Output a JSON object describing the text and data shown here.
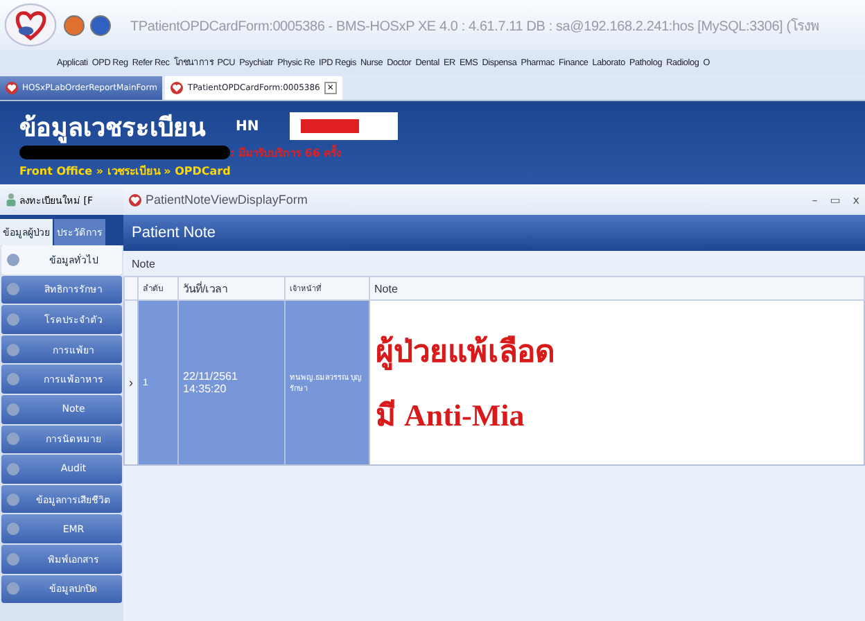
{
  "window": {
    "title": "TPatientOPDCardForm:0005386 - BMS-HOSxP XE 4.0 : 4.61.7.11 DB : sa@192.168.2.241:hos [MySQL:3306] (โรงพ"
  },
  "menu": [
    "Applicati",
    "OPD Reg",
    "Refer Rec",
    "โภชนาการ",
    "PCU",
    "Psychiatr",
    "Physic Re",
    "IPD Regis",
    "Nurse",
    "Doctor",
    "Dental",
    "ER",
    "EMS",
    "Dispensa",
    "Pharmac",
    "Finance",
    "Laborato",
    "Patholog",
    "Radiolog",
    "O"
  ],
  "doc_tabs": [
    {
      "label": "HOSxPLabOrderReportMainForm",
      "selected": false
    },
    {
      "label": "TPatientOPDCardForm:0005386",
      "selected": true,
      "close": "✕"
    }
  ],
  "header": {
    "title": "ข้อมูลเวชระเบียน",
    "hn_label": "HN",
    "visit_text": ": มีมารับบริการ 66 ครั้ง",
    "breadcrumb": "Front Office » เวชระเบียน » OPDCard"
  },
  "toolbar": {
    "new_button": "ลงทะเบียนใหม่ [F"
  },
  "side_tabs": [
    {
      "label": "ข้อมูลผู้ป่วย",
      "selected": true
    },
    {
      "label": "ประวัติการ",
      "selected": false
    }
  ],
  "sidebar": {
    "items": [
      {
        "label": "ข้อมูลทั่วไป",
        "selected": true
      },
      {
        "label": "สิทธิการรักษา",
        "selected": false
      },
      {
        "label": "โรคประจำตัว",
        "selected": false
      },
      {
        "label": "การแพ้ยา",
        "selected": false
      },
      {
        "label": "การแพ้อาหาร",
        "selected": false
      },
      {
        "label": "Note",
        "selected": false
      },
      {
        "label": "การนัดหมาย",
        "selected": false
      },
      {
        "label": "Audit",
        "selected": false
      },
      {
        "label": "ข้อมูลการเสียชีวิต",
        "selected": false
      },
      {
        "label": "EMR",
        "selected": false
      },
      {
        "label": "พิมพ์เอกสาร",
        "selected": false
      },
      {
        "label": "ข้อมูลปกปิด",
        "selected": false
      }
    ]
  },
  "note_window": {
    "title": "PatientNoteViewDisplayForm",
    "controls": [
      "–",
      "▭",
      "x"
    ],
    "heading": "Patient Note",
    "section": "Note",
    "table": {
      "columns": [
        "ลำดับ",
        "วันที่/เวลา",
        "เจ้าหน้าที่",
        "Note"
      ],
      "rows": [
        {
          "selected": true,
          "indicator": "›",
          "cells": [
            "1",
            "22/11/2561 14:35:20",
            "ทนพญ.ธมลวรรณ บุญรักษา"
          ],
          "note_lines": [
            "ผู้ป่วยแพ้เลือด",
            "มี Anti-Mia"
          ]
        }
      ]
    }
  }
}
